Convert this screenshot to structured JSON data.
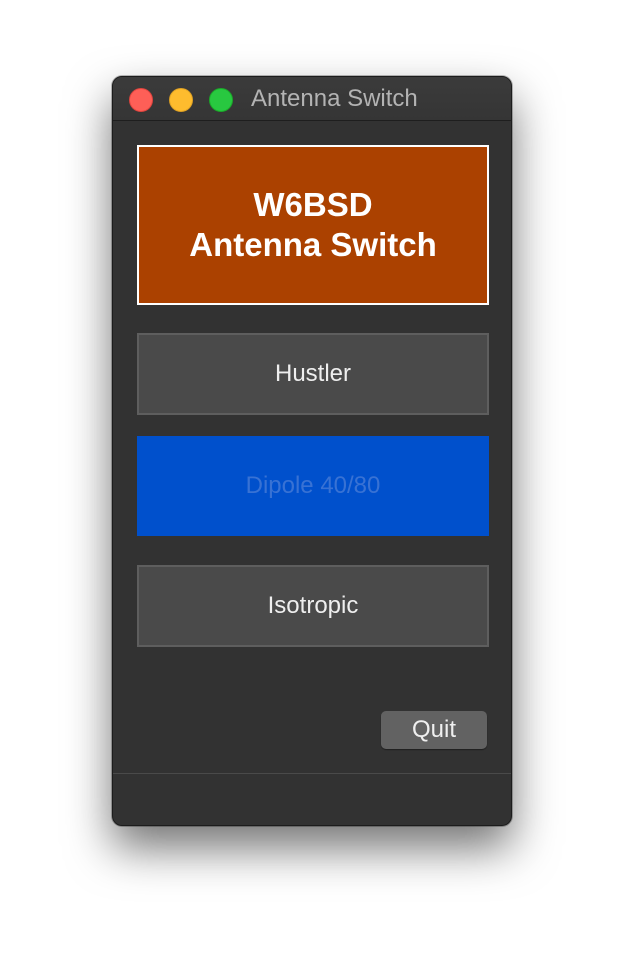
{
  "window": {
    "title": "Antenna Switch"
  },
  "banner": {
    "line1": "W6BSD",
    "line2": "Antenna Switch",
    "background": "#ab4100"
  },
  "antennas": [
    {
      "label": "Hustler",
      "state": "inactive"
    },
    {
      "label": "Dipole 40/80",
      "state": "active"
    },
    {
      "label": "Isotropic",
      "state": "inactive"
    }
  ],
  "quit": {
    "label": "Quit"
  },
  "colors": {
    "active_button": "#0050cc",
    "inactive_button": "#4a4a4a",
    "window_background": "#323232"
  }
}
